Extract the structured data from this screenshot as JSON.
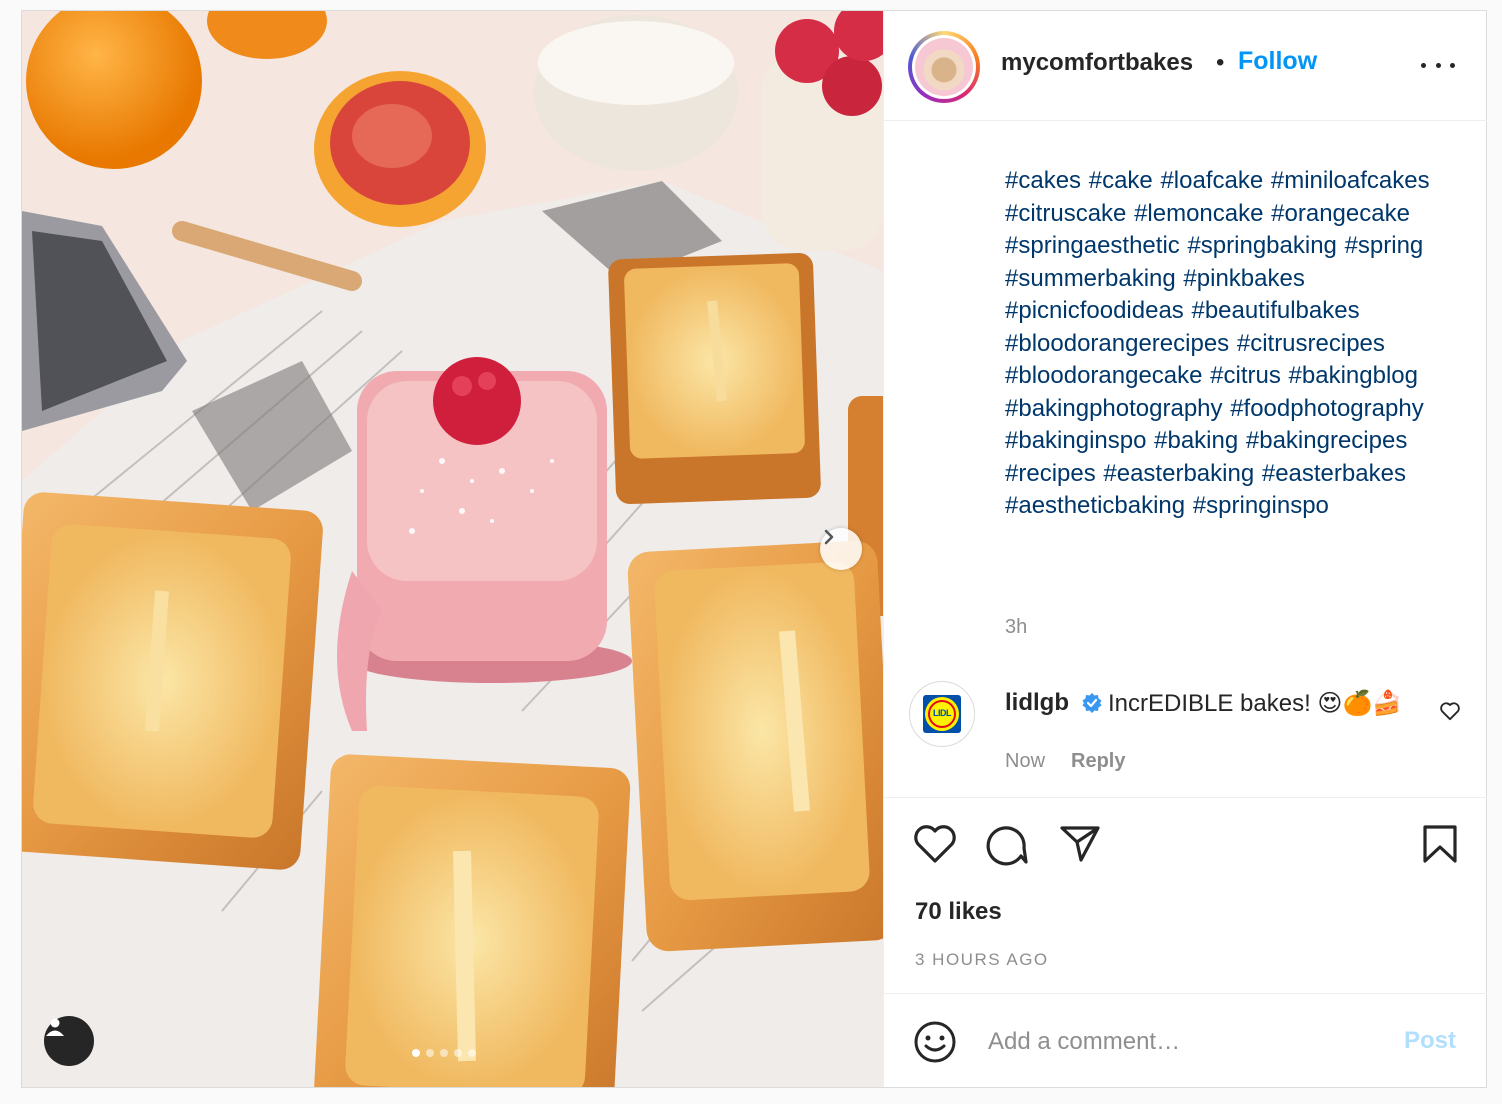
{
  "post": {
    "username": "mycomfortbakes",
    "separator": "•",
    "follow_label": "Follow",
    "hashtags": [
      "#cakes",
      "#cake",
      "#loafcake",
      "#miniloafcakes",
      "#citruscake",
      "#lemoncake",
      "#orangecake",
      "#springaesthetic",
      "#springbaking",
      "#spring",
      "#summerbaking",
      "#pinkbakes",
      "#picnicfoodideas",
      "#beautifulbakes",
      "#bloodorangerecipes",
      "#citrusrecipes",
      "#bloodorangecake",
      "#citrus",
      "#bakingblog",
      "#bakingphotography",
      "#foodphotography",
      "#bakinginspo",
      "#baking",
      "#bakingrecipes",
      "#recipes",
      "#easterbaking",
      "#easterbakes",
      "#aestheticbaking",
      "#springinspo"
    ],
    "caption_time": "3h",
    "likes": "70 likes",
    "posted_ago": "3 HOURS AGO",
    "carousel": {
      "count": 5,
      "active_index": 0
    }
  },
  "comment": {
    "username": "lidlgb",
    "text": "IncrEDIBLE bakes! 😍🍊🍰",
    "time": "Now",
    "reply_label": "Reply",
    "avatar_logo_text": "LIDL"
  },
  "add_comment": {
    "placeholder": "Add a comment…",
    "post_label": "Post"
  },
  "colors": {
    "link": "#00376b",
    "follow": "#0095f6",
    "muted": "#8e8e8e",
    "post_disabled": "#b2dffc"
  },
  "icons": [
    "more-options-icon",
    "chevron-right-icon",
    "user-tag-icon",
    "verified-badge-icon",
    "heart-icon",
    "comment-icon",
    "share-icon",
    "bookmark-icon",
    "emoji-icon"
  ]
}
